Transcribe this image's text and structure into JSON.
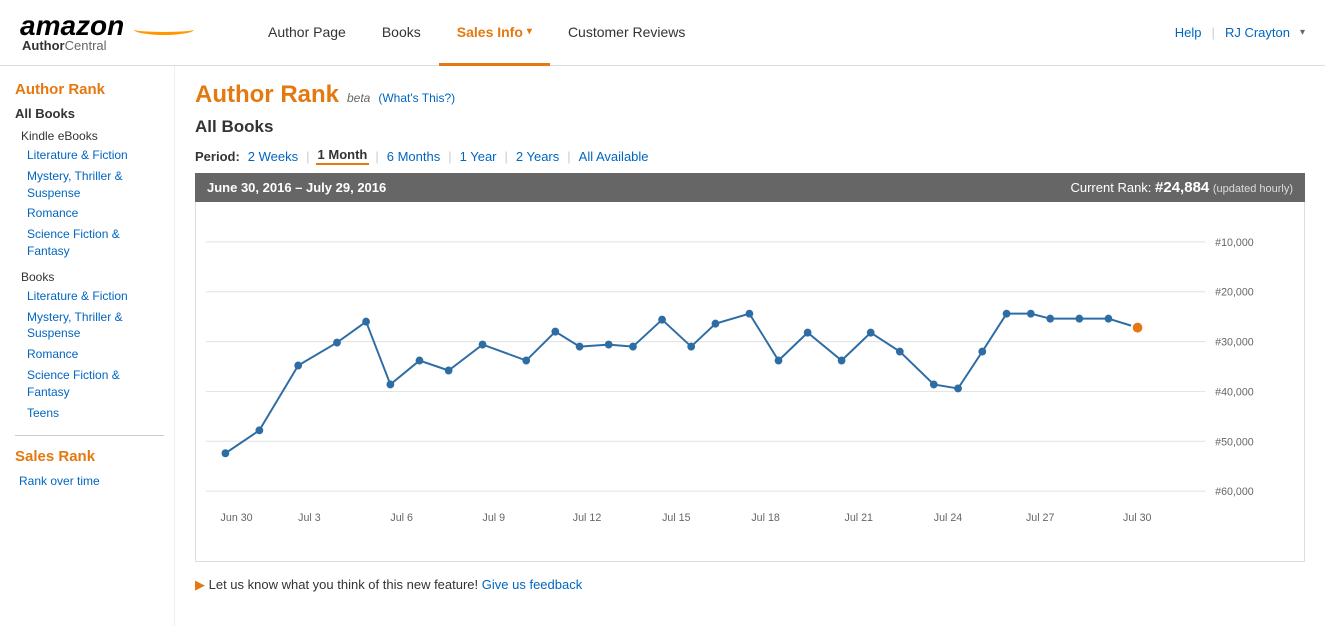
{
  "logo": {
    "amazon_text": "amazon",
    "sub_author": "Author",
    "sub_central": "Central"
  },
  "nav": {
    "links": [
      {
        "id": "author-page",
        "label": "Author Page",
        "active": false,
        "dropdown": false
      },
      {
        "id": "books",
        "label": "Books",
        "active": false,
        "dropdown": false
      },
      {
        "id": "sales-info",
        "label": "Sales Info",
        "active": true,
        "dropdown": true
      },
      {
        "id": "customer-reviews",
        "label": "Customer Reviews",
        "active": false,
        "dropdown": false
      }
    ],
    "help_label": "Help",
    "user_name": "RJ Crayton"
  },
  "sidebar": {
    "author_rank_title": "Author Rank",
    "all_books_label": "All Books",
    "kindle_group": "Kindle eBooks",
    "kindle_items": [
      "Literature & Fiction",
      "Mystery, Thriller & Suspense",
      "Romance",
      "Science Fiction & Fantasy"
    ],
    "books_group": "Books",
    "books_items": [
      "Literature & Fiction",
      "Mystery, Thriller & Suspense",
      "Romance",
      "Science Fiction & Fantasy",
      "Teens"
    ],
    "sales_rank_title": "Sales Rank",
    "rank_over_time": "Rank over time"
  },
  "content": {
    "page_title": "Author Rank",
    "beta_label": "beta",
    "whats_this": "(What's This?)",
    "subtitle": "All Books",
    "period_label": "Period:",
    "periods": [
      {
        "label": "2 Weeks",
        "active": false
      },
      {
        "label": "1 Month",
        "active": true
      },
      {
        "label": "6 Months",
        "active": false
      },
      {
        "label": "1 Year",
        "active": false
      },
      {
        "label": "2 Years",
        "active": false
      },
      {
        "label": "All Available",
        "active": false
      }
    ],
    "date_range": "June 30, 2016 – July 29, 2016",
    "current_rank_label": "Current Rank:",
    "current_rank_value": "#24,884",
    "current_rank_updated": "(updated hourly)"
  },
  "chart": {
    "y_labels": [
      "#10,000",
      "#20,000",
      "#30,000",
      "#40,000",
      "#50,000",
      "#60,000"
    ],
    "x_labels": [
      "Jun 30",
      "Jul 3",
      "Jul 6",
      "Jul 9",
      "Jul 12",
      "Jul 15",
      "Jul 18",
      "Jul 21",
      "Jul 24",
      "Jul 27",
      "Jul 30"
    ]
  },
  "footer": {
    "feedback_text": "Let us know what you think of this new feature!",
    "feedback_link": "Give us feedback"
  }
}
